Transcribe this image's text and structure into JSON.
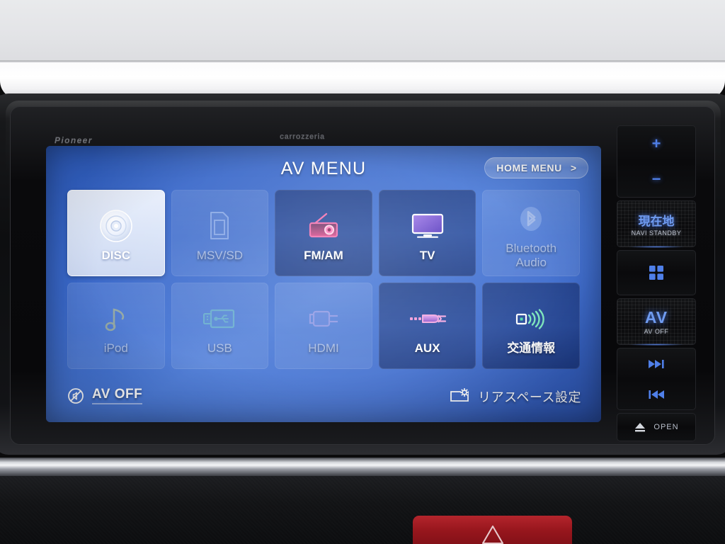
{
  "device": {
    "brand_left": "Pioneer",
    "brand_center": "carrozzeria"
  },
  "screen": {
    "header": {
      "title": "AV MENU",
      "home_menu_label": "HOME MENU",
      "home_menu_chevron": ">"
    },
    "tiles": [
      {
        "id": "disc",
        "label": "DISC",
        "icon": "disc-icon",
        "state": "selected"
      },
      {
        "id": "msv-sd",
        "label": "MSV/SD",
        "icon": "sd-card-icon",
        "state": "disabled"
      },
      {
        "id": "fm-am",
        "label": "FM/AM",
        "icon": "radio-icon",
        "state": "active"
      },
      {
        "id": "tv",
        "label": "TV",
        "icon": "tv-icon",
        "state": "active"
      },
      {
        "id": "bt-audio",
        "label": "Bluetooth\nAudio",
        "icon": "bluetooth-icon",
        "state": "disabled"
      },
      {
        "id": "ipod",
        "label": "iPod",
        "icon": "music-note-icon",
        "state": "disabled"
      },
      {
        "id": "usb",
        "label": "USB",
        "icon": "usb-icon",
        "state": "disabled"
      },
      {
        "id": "hdmi",
        "label": "HDMI",
        "icon": "hdmi-icon",
        "state": "disabled"
      },
      {
        "id": "aux",
        "label": "AUX",
        "icon": "aux-jack-icon",
        "state": "active"
      },
      {
        "id": "traffic",
        "label": "交通情報",
        "icon": "broadcast-icon",
        "state": "active"
      }
    ],
    "footer": {
      "av_off_label": "AV OFF",
      "av_off_icon": "av-off-icon",
      "rear_space_label": "リアスペース設定",
      "rear_space_icon": "rear-screen-gear-icon"
    },
    "colors": {
      "screen_blue": "#3a69cb",
      "tile_active": "#16306f",
      "tile_selected": "#dbe5f8",
      "text_white": "#ffffff"
    }
  },
  "hardkeys": {
    "volume_up": "+",
    "volume_down": "−",
    "navi_label": "現在地",
    "navi_sub": "NAVI STANDBY",
    "apps_icon": "grid-apps-icon",
    "av_label": "AV",
    "av_sub": "AV OFF",
    "track_next_icon": "next-track-icon",
    "track_prev_icon": "prev-track-icon",
    "eject_icon": "eject-icon",
    "open_label": "OPEN",
    "colors": {
      "key_glow": "#4f7fe8"
    }
  },
  "dashboard": {
    "hazard_icon": "hazard-triangle-icon",
    "hazard_color": "#97161d"
  }
}
